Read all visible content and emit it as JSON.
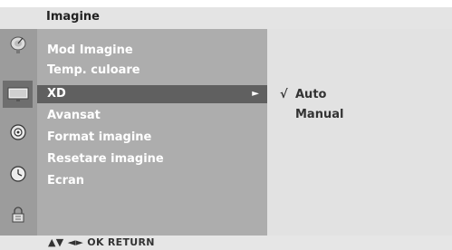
{
  "header": {
    "title": "Imagine"
  },
  "sidebar_icons": [
    {
      "name": "satellite-dish-icon",
      "active": false
    },
    {
      "name": "tv-picture-icon",
      "active": true
    },
    {
      "name": "speaker-icon",
      "active": false
    },
    {
      "name": "clock-icon",
      "active": false
    },
    {
      "name": "lock-icon",
      "active": false
    }
  ],
  "menu": {
    "items": [
      {
        "label": "Mod Imagine"
      },
      {
        "label": "Temp. culoare"
      },
      {
        "label": "XD",
        "selected": true
      },
      {
        "label": "Avansat"
      },
      {
        "label": "Format imagine"
      },
      {
        "label": "Resetare imagine"
      },
      {
        "label": "Ecran"
      }
    ],
    "selected_arrow": "►"
  },
  "submenu": {
    "check_mark": "√",
    "options": [
      {
        "label": "Auto",
        "checked": true
      },
      {
        "label": "Manual",
        "checked": false
      }
    ]
  },
  "footer": {
    "hint": "▲▼ ◄► OK  RETURN"
  },
  "colors": {
    "selected_row": "#606060",
    "menu_bg": "#adadad",
    "submenu_bg": "#e2e2e2"
  }
}
